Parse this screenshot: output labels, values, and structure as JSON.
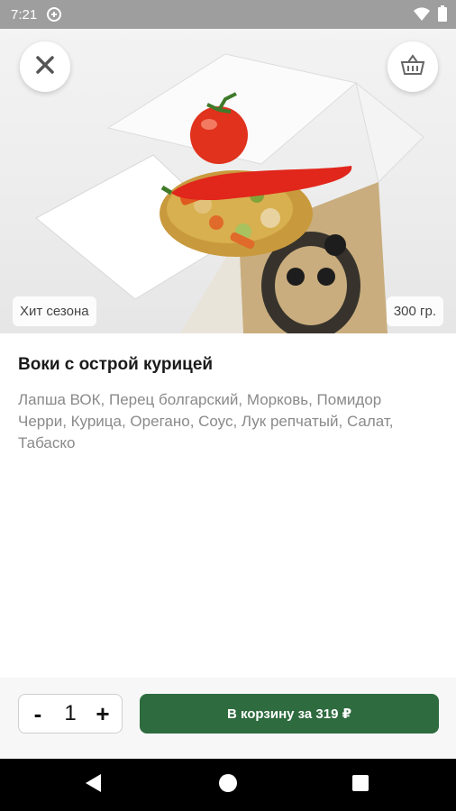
{
  "status_bar": {
    "time": "7:21"
  },
  "hero": {
    "tag_left": "Хит сезона",
    "tag_right": "300 гр."
  },
  "product": {
    "title": "Воки с острой курицей",
    "ingredients": "Лапша ВОК, Перец болгарский, Морковь, Помидор Черри, Курица, Орегано, Соус, Лук репчатый, Салат, Табаско"
  },
  "order": {
    "minus_label": "-",
    "quantity": "1",
    "plus_label": "+",
    "cart_button_label": "В корзину за 319 ₽"
  },
  "colors": {
    "accent": "#2e6b3e",
    "status_bar": "#9e9e9e",
    "nav_bar": "#000000"
  },
  "icons": {
    "close": "close-icon",
    "basket": "basket-icon",
    "back": "back-triangle-icon",
    "home": "home-circle-icon",
    "recent": "recent-square-icon"
  }
}
